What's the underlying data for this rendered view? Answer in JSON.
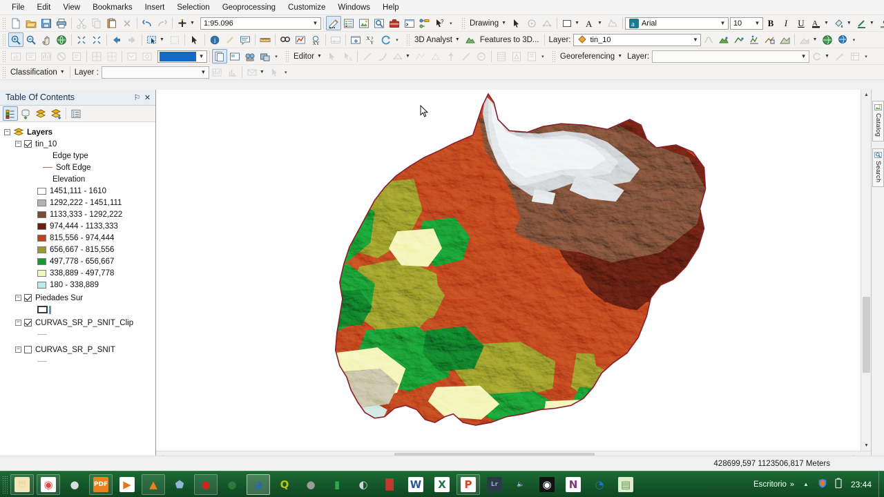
{
  "app": {
    "title": "ArcMap"
  },
  "menubar": {
    "items": [
      {
        "label": "File"
      },
      {
        "label": "Edit"
      },
      {
        "label": "View"
      },
      {
        "label": "Bookmarks"
      },
      {
        "label": "Insert"
      },
      {
        "label": "Selection"
      },
      {
        "label": "Geoprocessing"
      },
      {
        "label": "Customize"
      },
      {
        "label": "Windows"
      },
      {
        "label": "Help"
      }
    ]
  },
  "standard_toolbar": {
    "scale_value": "1:95.096",
    "icons": [
      "new-map-icon",
      "open-icon",
      "save-icon",
      "print-icon",
      "cut-icon",
      "copy-icon",
      "paste-icon",
      "delete-icon",
      "undo-icon",
      "redo-icon",
      "add-data-icon",
      "editor-toolbar-icon",
      "table-of-contents-icon",
      "catalog-icon",
      "search-icon",
      "arctoolbox-icon",
      "python-window-icon",
      "model-builder-icon",
      "whats-this-icon"
    ]
  },
  "drawing_toolbar": {
    "menu_label": "Drawing",
    "font_name": "Arial",
    "font_size": "10",
    "bold": "B",
    "italic": "I",
    "underline": "U"
  },
  "tools_toolbar": {
    "icons": [
      "zoom-in-icon",
      "zoom-out-icon",
      "pan-icon",
      "full-extent-icon",
      "fixed-zoom-in-icon",
      "fixed-zoom-out-icon",
      "back-extent-icon",
      "forward-extent-icon",
      "select-features-icon",
      "clear-selection-icon",
      "select-elements-icon",
      "identify-icon",
      "hyperlink-icon",
      "html-popup-icon",
      "measure-icon",
      "find-icon",
      "find-route-icon",
      "go-to-xy-icon",
      "time-slider-icon",
      "create-viewer-window-icon",
      "refresh-icon"
    ]
  },
  "analyst_toolbar": {
    "menu_label": "3D Analyst",
    "features_to_3d_label": "Features to 3D...",
    "layer_label": "Layer:",
    "layer_value": "tin_10"
  },
  "labeling_toolbar": {
    "color_swatch": "#1569c7"
  },
  "editor_toolbar": {
    "menu_label": "Editor"
  },
  "georeferencing_toolbar": {
    "menu_label": "Georeferencing",
    "layer_label": "Layer:",
    "layer_value": ""
  },
  "classification_toolbar": {
    "menu_label": "Classification",
    "layer_label": "Layer :",
    "layer_value": ""
  },
  "toc": {
    "title": "Table Of Contents",
    "pin_glyph": "⚐",
    "close_glyph": "✕",
    "tool_icons": [
      "list-by-drawing-order-icon",
      "list-by-source-icon",
      "list-by-visibility-icon",
      "list-by-selection-icon",
      "options-icon"
    ],
    "root": "Layers",
    "layers": [
      {
        "name": "tin_10",
        "checked": true,
        "groups": [
          {
            "heading": "Edge type",
            "entries": [
              {
                "label": "Soft Edge",
                "symbol": "line",
                "color": "#b06a6a"
              }
            ]
          },
          {
            "heading": "Elevation",
            "entries": [
              {
                "label": "1451,111 - 1610",
                "symbol": "fill",
                "color": "#ffffff"
              },
              {
                "label": "1292,222 - 1451,111",
                "symbol": "fill",
                "color": "#b4b4b4"
              },
              {
                "label": "1133,333 - 1292,222",
                "symbol": "fill",
                "color": "#7b4b33"
              },
              {
                "label": "974,444 - 1133,333",
                "symbol": "fill",
                "color": "#6b1d10"
              },
              {
                "label": "815,556 - 974,444",
                "symbol": "fill",
                "color": "#c0431a"
              },
              {
                "label": "656,667 - 815,556",
                "symbol": "fill",
                "color": "#9a9b26"
              },
              {
                "label": "497,778 - 656,667",
                "symbol": "fill",
                "color": "#159b2f"
              },
              {
                "label": "338,889 - 497,778",
                "symbol": "fill",
                "color": "#f4f5b8"
              },
              {
                "label": "180 - 338,889",
                "symbol": "fill",
                "color": "#b7eae8"
              }
            ]
          }
        ]
      },
      {
        "name": "Piedades Sur",
        "checked": true,
        "groups": [
          {
            "heading": "",
            "entries": [
              {
                "label": "",
                "symbol": "outline",
                "color": "#333333"
              }
            ]
          }
        ]
      },
      {
        "name": "CURVAS_SR_P_SNIT_Clip",
        "checked": true,
        "groups": [
          {
            "heading": "",
            "entries": [
              {
                "label": "",
                "symbol": "line",
                "color": "#b8b8b8"
              }
            ]
          }
        ]
      },
      {
        "name": "CURVAS_SR_P_SNIT",
        "checked": false,
        "groups": [
          {
            "heading": "",
            "entries": [
              {
                "label": "",
                "symbol": "line",
                "color": "#b8b8b8"
              }
            ]
          }
        ]
      }
    ]
  },
  "map": {
    "background": "#ffffff",
    "boundary_color": "#8a1f2a",
    "cursor": "arrow-cursor",
    "view_buttons": [
      {
        "name": "data-view",
        "glyph": "▣",
        "selected": true
      },
      {
        "name": "layout-view",
        "glyph": "▧",
        "selected": false
      },
      {
        "name": "refresh-view",
        "glyph": "↻",
        "selected": false
      },
      {
        "name": "pause-drawing",
        "glyph": "‖",
        "selected": false
      },
      {
        "name": "previous-extent",
        "glyph": "‹",
        "selected": false
      }
    ]
  },
  "dock_tabs": [
    {
      "label": "Catalog",
      "icon": "catalog-icon"
    },
    {
      "label": "Search",
      "icon": "search-icon"
    }
  ],
  "status": {
    "coordinates": "428699,597  1123506,817 Meters"
  },
  "taskbar": {
    "apps": [
      {
        "name": "file-explorer",
        "glyph": "🗂",
        "color": "#e8d9a0",
        "bg": "#f2e6b8",
        "state": "run"
      },
      {
        "name": "google-chrome",
        "glyph": "◉",
        "color": "#e8453c",
        "bg": "#ffffff",
        "state": "run"
      },
      {
        "name": "messaging-app",
        "glyph": "●",
        "color": "#d9dde0",
        "bg": "transparent",
        "state": "none"
      },
      {
        "name": "pdf-reader",
        "glyph": "PDF",
        "color": "#ffffff",
        "bg": "#e8821e",
        "state": "run"
      },
      {
        "name": "media-player",
        "glyph": "▶",
        "color": "#e07a1f",
        "bg": "#ffffff",
        "state": "none"
      },
      {
        "name": "vlc-player",
        "glyph": "▲",
        "color": "#e8821e",
        "bg": "transparent",
        "state": "run"
      },
      {
        "name": "steam-app",
        "glyph": "⬟",
        "color": "#8fb8d8",
        "bg": "transparent",
        "state": "none"
      },
      {
        "name": "opera-browser",
        "glyph": "●",
        "color": "#c8271f",
        "bg": "transparent",
        "state": "run"
      },
      {
        "name": "globe-app",
        "glyph": "●",
        "color": "#2b7a3c",
        "bg": "transparent",
        "state": "none"
      },
      {
        "name": "arcmap",
        "glyph": "◕",
        "color": "#2f6b9c",
        "bg": "transparent",
        "state": "active"
      },
      {
        "name": "qgis-app",
        "glyph": "Q",
        "color": "#b8c419",
        "bg": "transparent",
        "state": "none"
      },
      {
        "name": "grey-orb-app",
        "glyph": "●",
        "color": "#9a9a9a",
        "bg": "transparent",
        "state": "none"
      },
      {
        "name": "battery-app",
        "glyph": "▮",
        "color": "#2fa84f",
        "bg": "transparent",
        "state": "none"
      },
      {
        "name": "earth-app",
        "glyph": "◐",
        "color": "#cfd4d8",
        "bg": "transparent",
        "state": "none"
      },
      {
        "name": "tower-app",
        "glyph": "█",
        "color": "#c0392b",
        "bg": "transparent",
        "state": "none"
      },
      {
        "name": "microsoft-word",
        "glyph": "W",
        "color": "#2b579a",
        "bg": "#ffffff",
        "state": "none"
      },
      {
        "name": "microsoft-excel",
        "glyph": "X",
        "color": "#217346",
        "bg": "#ffffff",
        "state": "none"
      },
      {
        "name": "microsoft-powerpoint",
        "glyph": "P",
        "color": "#d24726",
        "bg": "#ffffff",
        "state": "run"
      },
      {
        "name": "lightroom",
        "glyph": "Lr",
        "color": "#8fa8c8",
        "bg": "#2b3a47",
        "state": "none"
      },
      {
        "name": "volume-app",
        "glyph": "🔈",
        "color": "#dddddd",
        "bg": "transparent",
        "state": "none"
      },
      {
        "name": "eye-app",
        "glyph": "◉",
        "color": "#ffffff",
        "bg": "#111111",
        "state": "none"
      },
      {
        "name": "onenote",
        "glyph": "N",
        "color": "#80397b",
        "bg": "#ffffff",
        "state": "none"
      },
      {
        "name": "google-earth",
        "glyph": "◔",
        "color": "#1a73c8",
        "bg": "transparent",
        "state": "none"
      },
      {
        "name": "notes-app",
        "glyph": "▤",
        "color": "#5a9a4a",
        "bg": "#dfeccd",
        "state": "none"
      }
    ],
    "desktop_label": "Escritorio",
    "overflow_glyph": "»",
    "tray_up_glyph": "▲",
    "tray_icons": [
      {
        "name": "security-shield-icon",
        "glyph": "⛨"
      },
      {
        "name": "battery-icon",
        "glyph": "▯"
      }
    ],
    "clock": "23:44"
  }
}
